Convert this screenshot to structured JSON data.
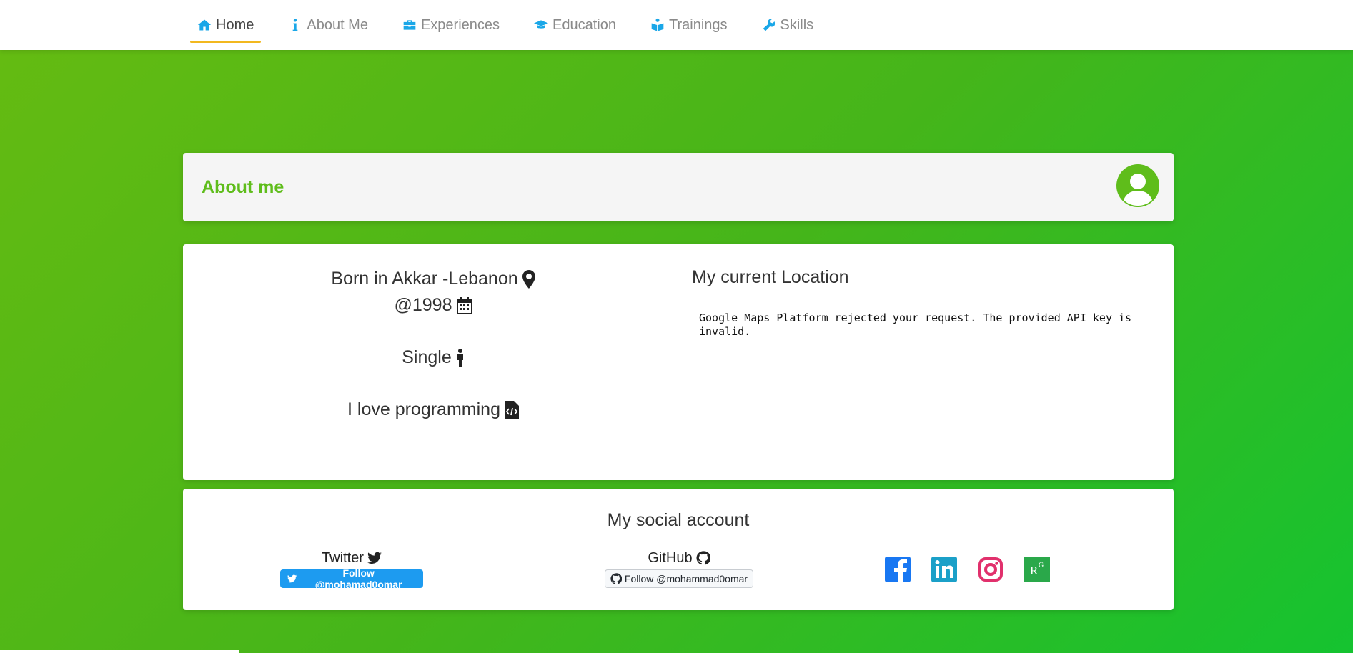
{
  "nav": {
    "items": [
      {
        "label": "Home",
        "icon": "home-icon"
      },
      {
        "label": "About Me",
        "icon": "info-icon"
      },
      {
        "label": "Experiences",
        "icon": "briefcase-icon"
      },
      {
        "label": "Education",
        "icon": "graduation-cap-icon"
      },
      {
        "label": "Trainings",
        "icon": "book-reader-icon"
      },
      {
        "label": "Skills",
        "icon": "wrench-icon"
      }
    ],
    "active": "Home"
  },
  "about": {
    "title": "About me",
    "born": "Born in Akkar -Lebanon",
    "year": "@1998",
    "status": "Single",
    "hobby": "I love programming"
  },
  "location": {
    "title": "My current Location",
    "error": "Google Maps Platform rejected your request. The provided API key is invalid."
  },
  "social": {
    "title": "My social account",
    "twitter_label": "Twitter",
    "twitter_button": "Follow @mohamad0omar",
    "github_label": "GitHub",
    "github_button": "Follow @mohammad0omar",
    "icons": [
      "facebook-icon",
      "linkedin-icon",
      "instagram-icon",
      "researchgate-icon"
    ]
  },
  "colors": {
    "accent": "#5fbd1b",
    "nav_icon": "#1aa7e8",
    "active_underline": "#f2b81f",
    "twitter_blue": "#1d9bf0"
  }
}
